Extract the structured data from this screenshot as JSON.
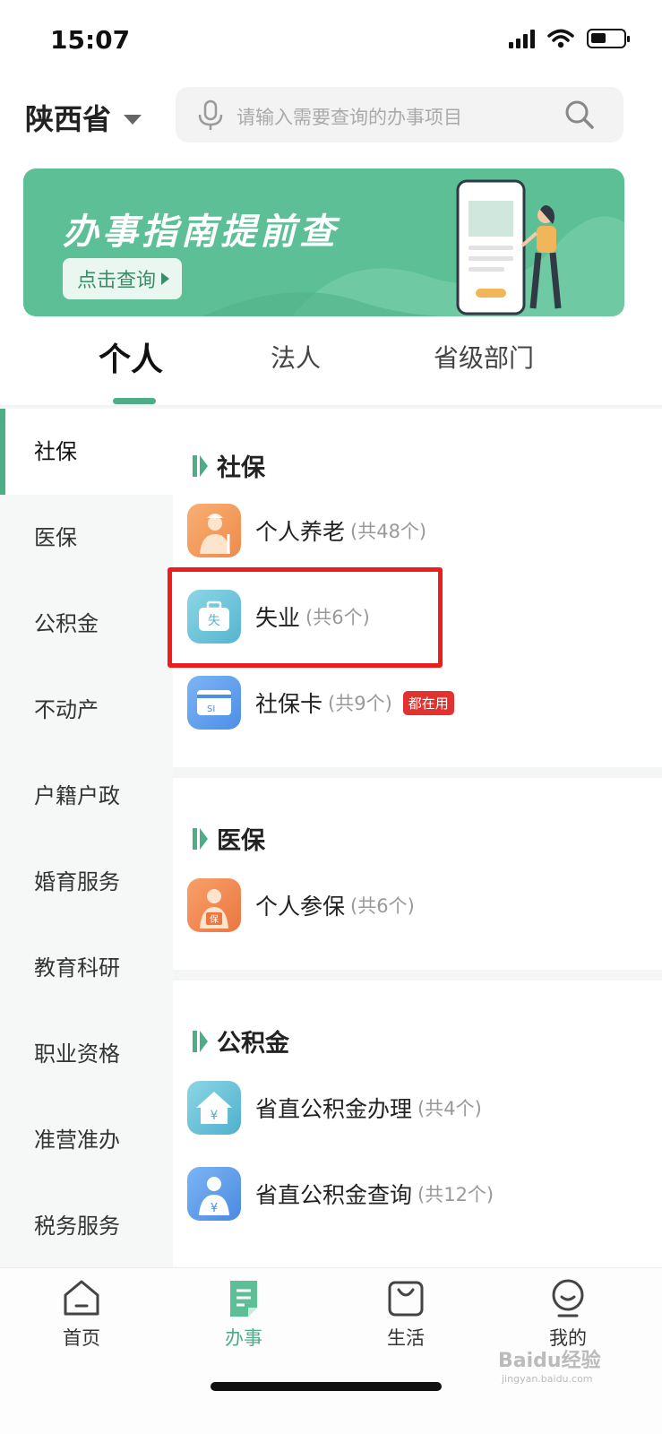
{
  "status_bar": {
    "time": "15:07"
  },
  "header": {
    "province": "陕西省",
    "search_placeholder": "请输入需要查询的办事项目"
  },
  "banner": {
    "title": "办事指南提前查",
    "button_label": "点击查询"
  },
  "tabs": [
    {
      "label": "个人",
      "active": true
    },
    {
      "label": "法人",
      "active": false
    },
    {
      "label": "省级部门",
      "active": false
    }
  ],
  "sidebar": {
    "items": [
      {
        "label": "社保",
        "active": true
      },
      {
        "label": "医保"
      },
      {
        "label": "公积金"
      },
      {
        "label": "不动产"
      },
      {
        "label": "户籍户政"
      },
      {
        "label": "婚育服务"
      },
      {
        "label": "教育科研"
      },
      {
        "label": "职业资格"
      },
      {
        "label": "准营准办"
      },
      {
        "label": "税务服务"
      }
    ]
  },
  "sections": [
    {
      "title": "社保",
      "items": [
        {
          "name": "个人养老",
          "count": "(共48个)",
          "icon": "elderly-person-icon"
        },
        {
          "name": "失业",
          "count": "(共6个)",
          "icon": "briefcase-icon",
          "highlighted": true
        },
        {
          "name": "社保卡",
          "count": "(共9个)",
          "badge": "都在用",
          "icon": "si-card-icon"
        }
      ]
    },
    {
      "title": "医保",
      "items": [
        {
          "name": "个人参保",
          "count": "(共6个)",
          "icon": "insured-person-icon"
        }
      ]
    },
    {
      "title": "公积金",
      "items": [
        {
          "name": "省直公积金办理",
          "count": "(共4个)",
          "icon": "house-yuan-icon"
        },
        {
          "name": "省直公积金查询",
          "count": "(共12个)",
          "icon": "person-yuan-icon"
        }
      ]
    }
  ],
  "bottom_nav": [
    {
      "label": "首页",
      "icon": "home-icon"
    },
    {
      "label": "办事",
      "icon": "document-icon",
      "active": true
    },
    {
      "label": "生活",
      "icon": "shopping-bag-icon"
    },
    {
      "label": "我的",
      "icon": "profile-icon"
    }
  ],
  "watermark": {
    "main": "Baidu经验",
    "sub": "jingyan.baidu.com"
  },
  "colors": {
    "accent": "#4dad87",
    "banner": "#5cbf96",
    "badge": "#e0322f",
    "highlight": "#ef1c1c"
  }
}
